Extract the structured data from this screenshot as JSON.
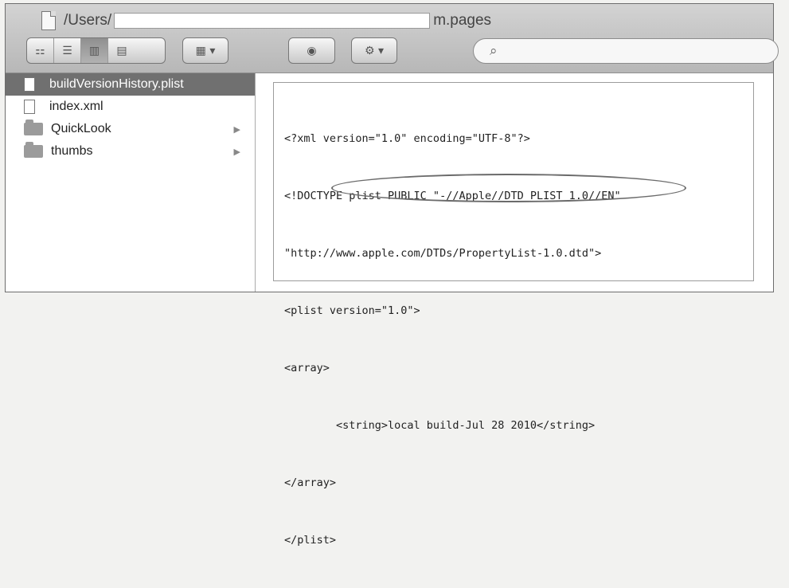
{
  "window": {
    "title_prefix": "/Users/",
    "title_suffix": "m.pages"
  },
  "toolbar": {
    "view_icons": [
      "icon-view",
      "list-view",
      "column-view",
      "coverflow-view"
    ],
    "arrange_icon": "arrange-menu-icon",
    "quicklook_icon": "eye-icon",
    "action_icon": "gear-icon",
    "search_placeholder": "",
    "search_icon": "magnifier-icon"
  },
  "sidebar": {
    "items": [
      {
        "label": "buildVersionHistory.plist",
        "type": "file",
        "selected": true
      },
      {
        "label": "index.xml",
        "type": "file",
        "selected": false
      },
      {
        "label": "QuickLook",
        "type": "folder",
        "selected": false
      },
      {
        "label": "thumbs",
        "type": "folder",
        "selected": false
      }
    ]
  },
  "preview": {
    "lines": [
      "<?xml version=\"1.0\" encoding=\"UTF-8\"?>",
      "<!DOCTYPE plist PUBLIC \"-//Apple//DTD PLIST 1.0//EN\"",
      "\"http://www.apple.com/DTDs/PropertyList-1.0.dtd\">",
      "<plist version=\"1.0\">",
      "<array>",
      "        <string>local build-Jul 28 2010</string>",
      "</array>",
      "</plist>"
    ]
  }
}
